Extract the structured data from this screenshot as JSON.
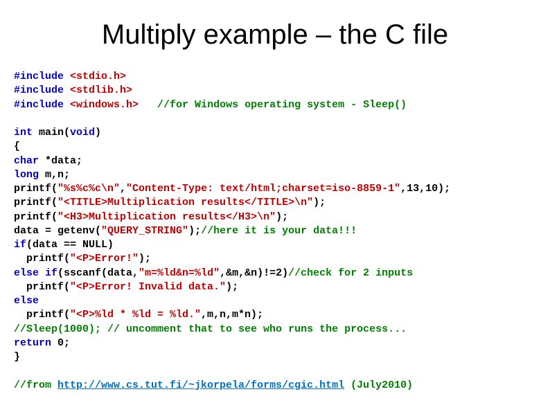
{
  "title": "Multiply example – the C file",
  "code": {
    "inc1_kw": "#include",
    "inc1_hdr": " <stdio.h>",
    "inc2_kw": "#include",
    "inc2_hdr": " <stdlib.h>",
    "inc3_kw": "#include",
    "inc3_hdr": " <windows.h>",
    "inc3_cmt": "   //for Windows operating system - Sleep()",
    "blank1": "",
    "main1a": "int",
    "main1b": " main(",
    "main1c": "void",
    "main1d": ")",
    "main2": "{",
    "main3a": "char",
    "main3b": " *data;",
    "main4a": "long",
    "main4b": " m,n;",
    "p1a": "printf(",
    "p1b": "\"%s%c%c\\n\"",
    "p1c": ",",
    "p1d": "\"Content-Type: text/html;charset=iso-8859-1\"",
    "p1e": ",13,10);",
    "p2a": "printf(",
    "p2b": "\"<TITLE>Multiplication results</TITLE>\\n\"",
    "p2c": ");",
    "p3a": "printf(",
    "p3b": "\"<H3>Multiplication results</H3>\\n\"",
    "p3c": ");",
    "d1a": "data = getenv(",
    "d1b": "\"QUERY_STRING\"",
    "d1c": ");",
    "d1d": "//here it is your data!!!",
    "if1a": "if",
    "if1b": "(data == NULL)",
    "if2a": "  printf(",
    "if2b": "\"<P>Error!\"",
    "if2c": ");",
    "ei1a": "else if",
    "ei1b": "(sscanf(data,",
    "ei1c": "\"m=%ld&n=%ld\"",
    "ei1d": ",&m,&n)!=2)",
    "ei1e": "//check for 2 inputs",
    "ei2a": "  printf(",
    "ei2b": "\"<P>Error! Invalid data.\"",
    "ei2c": ");",
    "el1": "else",
    "el2a": "  printf(",
    "el2b": "\"<P>%ld * %ld = %ld.\"",
    "el2c": ",m,n,m*n);",
    "sl1": "//Sleep(1000); // uncomment that to see who runs the process...",
    "ret1a": "return",
    "ret1b": " 0;",
    "end": "}",
    "blank2": "",
    "from1": "//from ",
    "from_link": "http://www.cs.tut.fi/~jkorpela/forms/cgic.html",
    "from2": " (July2010)"
  }
}
